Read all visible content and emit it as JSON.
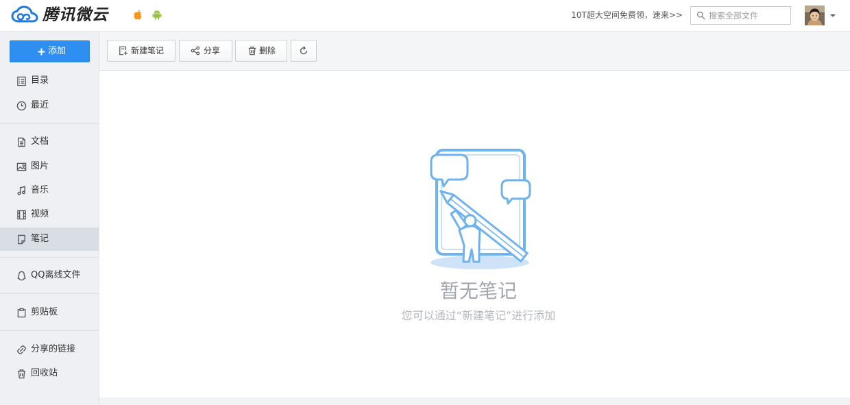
{
  "header": {
    "logo_text": "腾讯微云",
    "promo_link": "10T超大空间免费领，速来>>",
    "search": {
      "placeholder": "搜索全部文件",
      "value": ""
    },
    "icons": {
      "logo": "weiyun-cloud-logo-icon",
      "ios": "apple-icon",
      "android": "android-icon",
      "search": "search-icon",
      "avatar": "user-avatar",
      "account_menu": "caret-down-icon"
    }
  },
  "sidebar": {
    "add_button": {
      "label": "添加",
      "icon": "plus-icon"
    },
    "items": [
      {
        "label": "目录",
        "icon": "list-icon",
        "active": false
      },
      {
        "label": "最近",
        "icon": "clock-icon",
        "active": false
      },
      {
        "label": "文档",
        "icon": "document-icon",
        "active": false
      },
      {
        "label": "图片",
        "icon": "image-icon",
        "active": false
      },
      {
        "label": "音乐",
        "icon": "music-icon",
        "active": false
      },
      {
        "label": "视频",
        "icon": "video-icon",
        "active": false
      },
      {
        "label": "笔记",
        "icon": "note-icon",
        "active": true
      },
      {
        "label": "QQ离线文件",
        "icon": "qq-icon",
        "active": false
      },
      {
        "label": "剪贴板",
        "icon": "clipboard-icon",
        "active": false
      },
      {
        "label": "分享的链接",
        "icon": "link-icon",
        "active": false
      },
      {
        "label": "回收站",
        "icon": "trash-icon",
        "active": false
      }
    ]
  },
  "toolbar": {
    "buttons": [
      {
        "label": "新建笔记",
        "icon": "new-note-icon"
      },
      {
        "label": "分享",
        "icon": "share-icon"
      },
      {
        "label": "删除",
        "icon": "trash-icon"
      },
      {
        "icon": "refresh-icon"
      }
    ]
  },
  "empty_state": {
    "title": "暂无笔记",
    "hint": "您可以通过“新建笔记”进行添加",
    "illustration": "empty-notes-illustration"
  },
  "colors": {
    "accent": "#2f8ff0",
    "sidebar_bg": "#eef0f3",
    "active_item_bg": "#d9dde4",
    "illustration_stroke": "#6eb2ee",
    "empty_title": "#a2a7af",
    "empty_hint": "#b3b8bf"
  }
}
